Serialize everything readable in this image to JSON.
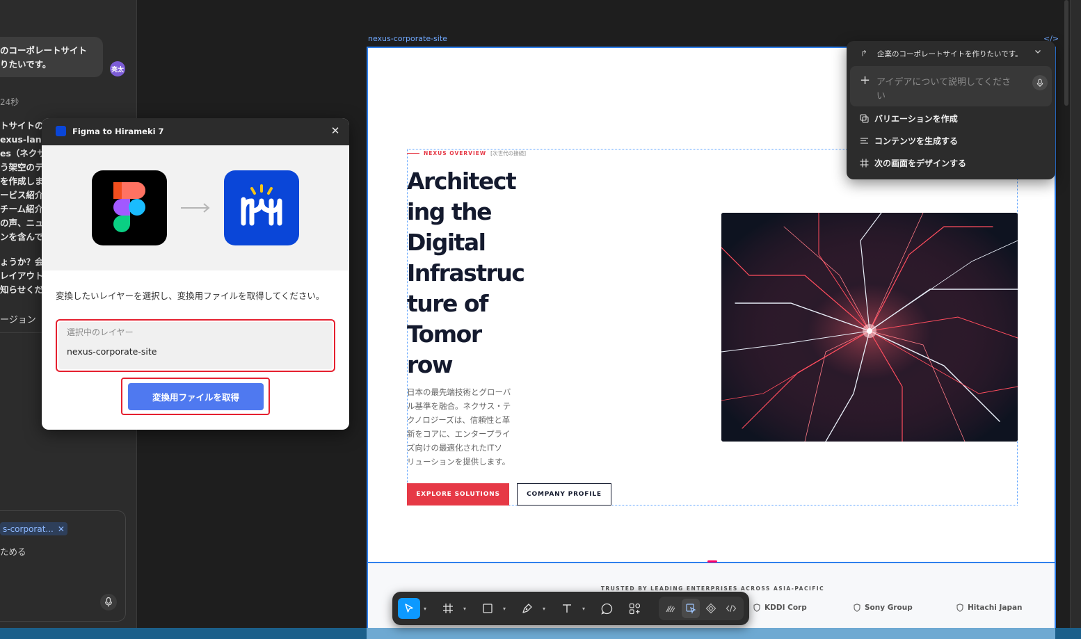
{
  "chat": {
    "user_message_lines": [
      "のコーポレートサイト",
      "りたいです。"
    ],
    "avatar_label": "亮太",
    "elapsed": "24秒",
    "reply_lines": [
      "トサイトの",
      "exus-landi",
      "es（ネクサ",
      "う架空のテ",
      "を作成しま",
      "ービス紹介",
      "チーム紹介",
      "の声、ニュ",
      "ンを含んで",
      "",
      "ょうか？会",
      "レイアウト",
      "知らせくだ"
    ],
    "version_label": "ージョン",
    "chip_label": "s-corporat...",
    "input_placeholder": "ためる"
  },
  "dialog": {
    "title": "Figma to Hirameki 7",
    "instruction": "変換したいレイヤーを選択し、変換用ファイルを取得してください。",
    "layer_label": "選択中のレイヤー",
    "layer_value": "nexus-corporate-site",
    "button_label": "変換用ファイルを取得"
  },
  "frame": {
    "name": "nexus-corporate-site",
    "overline": "NEXUS OVERVIEW",
    "overline_sub": "[次世代の接続]",
    "headline_lines": [
      "Architect",
      "ing the",
      "Digital",
      "Infrastruc",
      "ture of",
      "Tomor",
      "row"
    ],
    "body_lines": [
      "日本の最先端技術とグローバ",
      "ル基準を融合。ネクサス・テ",
      "クノロジーズは、信頼性と革",
      "新をコアに、エンタープライ",
      "ズ向けの最適化されたITソ",
      "リューションを提供します。"
    ],
    "explore_label": "EXPLORE SOLUTIONS",
    "profile_label": "COMPANY PROFILE",
    "trusted_title": "TRUSTED BY LEADING ENTERPRISES ACROSS ASIA-PACIFIC",
    "logos": [
      "KDDI Corp",
      "Sony Group",
      "Hitachi Japan"
    ]
  },
  "ai_popup": {
    "prompt": "企業のコーポレートサイトを作りたいです。",
    "input_placeholder": "アイデアについて説明してください",
    "items": [
      {
        "label": "バリエーションを作成",
        "icon": "duplicate-icon"
      },
      {
        "label": "コンテンツを生成する",
        "icon": "text-lines-icon"
      },
      {
        "label": "次の画面をデザインする",
        "icon": "frame-icon"
      }
    ]
  },
  "colors": {
    "accent_red": "#e63946",
    "figma_blue": "#2f80ed",
    "plugin_button": "#4f79f0",
    "hirameki_blue": "#0a46d8",
    "navy": "#141a2e"
  }
}
